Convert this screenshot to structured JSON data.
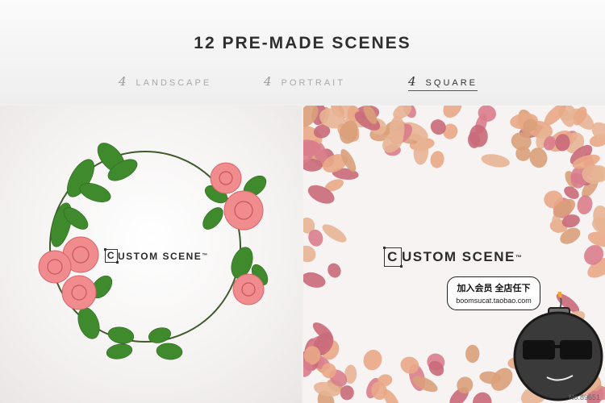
{
  "header": {
    "title": "12 PRE-MADE SCENES",
    "tabs": [
      {
        "count": "4",
        "label": "LANDSCAPE"
      },
      {
        "count": "4",
        "label": "PORTRAIT"
      },
      {
        "count": "4",
        "label": "SQUARE"
      }
    ]
  },
  "left_scene": {
    "label_first": "C",
    "label_rest": "USTOM SCENE",
    "tm": "™"
  },
  "right_scene": {
    "label_first": "C",
    "label_rest": "USTOM SCENE",
    "tm": "™"
  },
  "promo": {
    "line1": "加入会员 全店任下",
    "line2": "boomsucat.taobao.com"
  },
  "watermark": "No.89651",
  "colors": {
    "rose": "#f08b8e",
    "leaf": "#3f8a2c",
    "petal_gold": "#d9a07a",
    "petal_pink": "#d97d8c"
  }
}
